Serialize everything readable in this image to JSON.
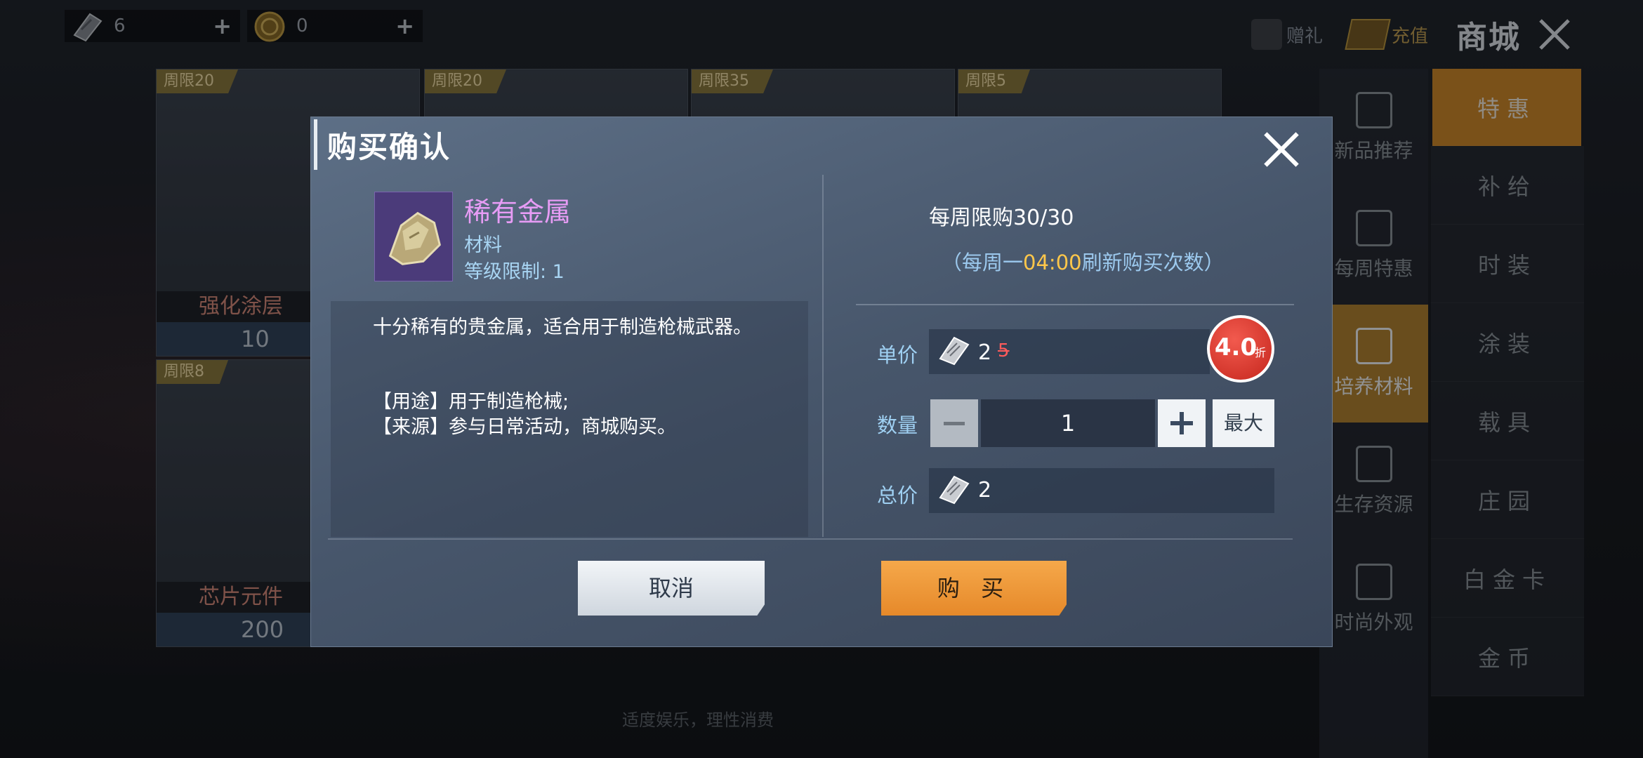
{
  "currencies": [
    {
      "icon": "ticket-icon",
      "value": "6",
      "plus": "+"
    },
    {
      "icon": "gold-coin-icon",
      "value": "0",
      "plus": "+"
    }
  ],
  "topbar": {
    "gift_label": "赠礼",
    "recharge_label": "充值",
    "title": "商城"
  },
  "tabs": [
    "特惠",
    "补给",
    "时装",
    "涂装",
    "载具",
    "庄园",
    "白金卡",
    "金币"
  ],
  "subtabs": [
    "新品推荐",
    "每周特惠",
    "培养材料",
    "生存资源",
    "时尚外观"
  ],
  "cards": [
    {
      "limit": "周限20",
      "name": "强化涂层",
      "price": "10"
    },
    {
      "limit": "周限20",
      "name": "",
      "price": ""
    },
    {
      "limit": "周限35",
      "name": "",
      "price": ""
    },
    {
      "limit": "周限5",
      "name": "",
      "price": ""
    },
    {
      "limit": "周限8",
      "name": "芯片元件",
      "price": "200"
    }
  ],
  "footer_note": "适度娱乐，理性消费",
  "dialog": {
    "title": "购买确认",
    "item": {
      "name": "稀有金属",
      "type": "材料",
      "level": "等级限制: 1",
      "description": "十分稀有的贵金属，适合用于制造枪械武器。",
      "usage": "【用途】用于制造枪械;",
      "source": "【来源】参与日常活动，商城购买。"
    },
    "weekly_limit": "每周限购30/30",
    "refresh_prefix": "（每周一",
    "refresh_time": "04:00",
    "refresh_suffix": "刷新购买次数）",
    "unit_price_label": "单价",
    "unit_price": "2",
    "original_price": "5",
    "discount": "4.0",
    "discount_unit": "折",
    "quantity_label": "数量",
    "quantity": "1",
    "max_label": "最大",
    "total_label": "总价",
    "total": "2",
    "cancel_label": "取消",
    "buy_label": "购 买"
  },
  "colors": {
    "accent_orange": "#e6892a",
    "item_name_purple": "#e79cf5",
    "label_blue": "#9fd0f2",
    "refresh_time_gold": "#ffc74a",
    "discount_red": "#c5261d"
  }
}
